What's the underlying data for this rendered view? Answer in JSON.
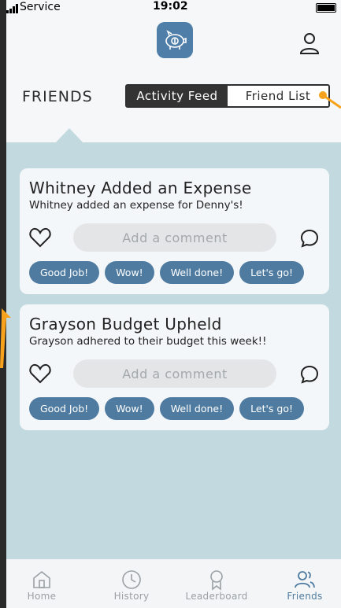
{
  "status_bar": {
    "carrier": "Service",
    "time": "19:02"
  },
  "header": {
    "logo_icon": "piggy-bank-icon",
    "profile_icon": "person-icon"
  },
  "page_title": "FRIENDS",
  "segmented": {
    "tabs": [
      "Activity Feed",
      "Friend List"
    ],
    "selected": "Activity Feed"
  },
  "feed": {
    "posts": [
      {
        "title": "Whitney Added an Expense",
        "description": "Whitney added an expense for Denny's!",
        "comment_placeholder": "Add a comment",
        "reactions": [
          "Good Job!",
          "Wow!",
          "Well done!",
          "Let's go!"
        ]
      },
      {
        "title": "Grayson Budget Upheld",
        "description": "Grayson adhered to their budget this week!!",
        "comment_placeholder": "Add a comment",
        "reactions": [
          "Good Job!",
          "Wow!",
          "Well done!",
          "Let's go!"
        ]
      }
    ]
  },
  "tab_bar": {
    "items": [
      {
        "label": "Home",
        "icon": "home-icon"
      },
      {
        "label": "History",
        "icon": "clock-icon"
      },
      {
        "label": "Leaderboard",
        "icon": "award-icon"
      },
      {
        "label": "Friends",
        "icon": "friends-icon"
      }
    ],
    "active": "Friends"
  },
  "colors": {
    "accent": "#4f7ba1",
    "feed_background": "#c2dadf",
    "annotation_arrow": "#f6a21d"
  }
}
